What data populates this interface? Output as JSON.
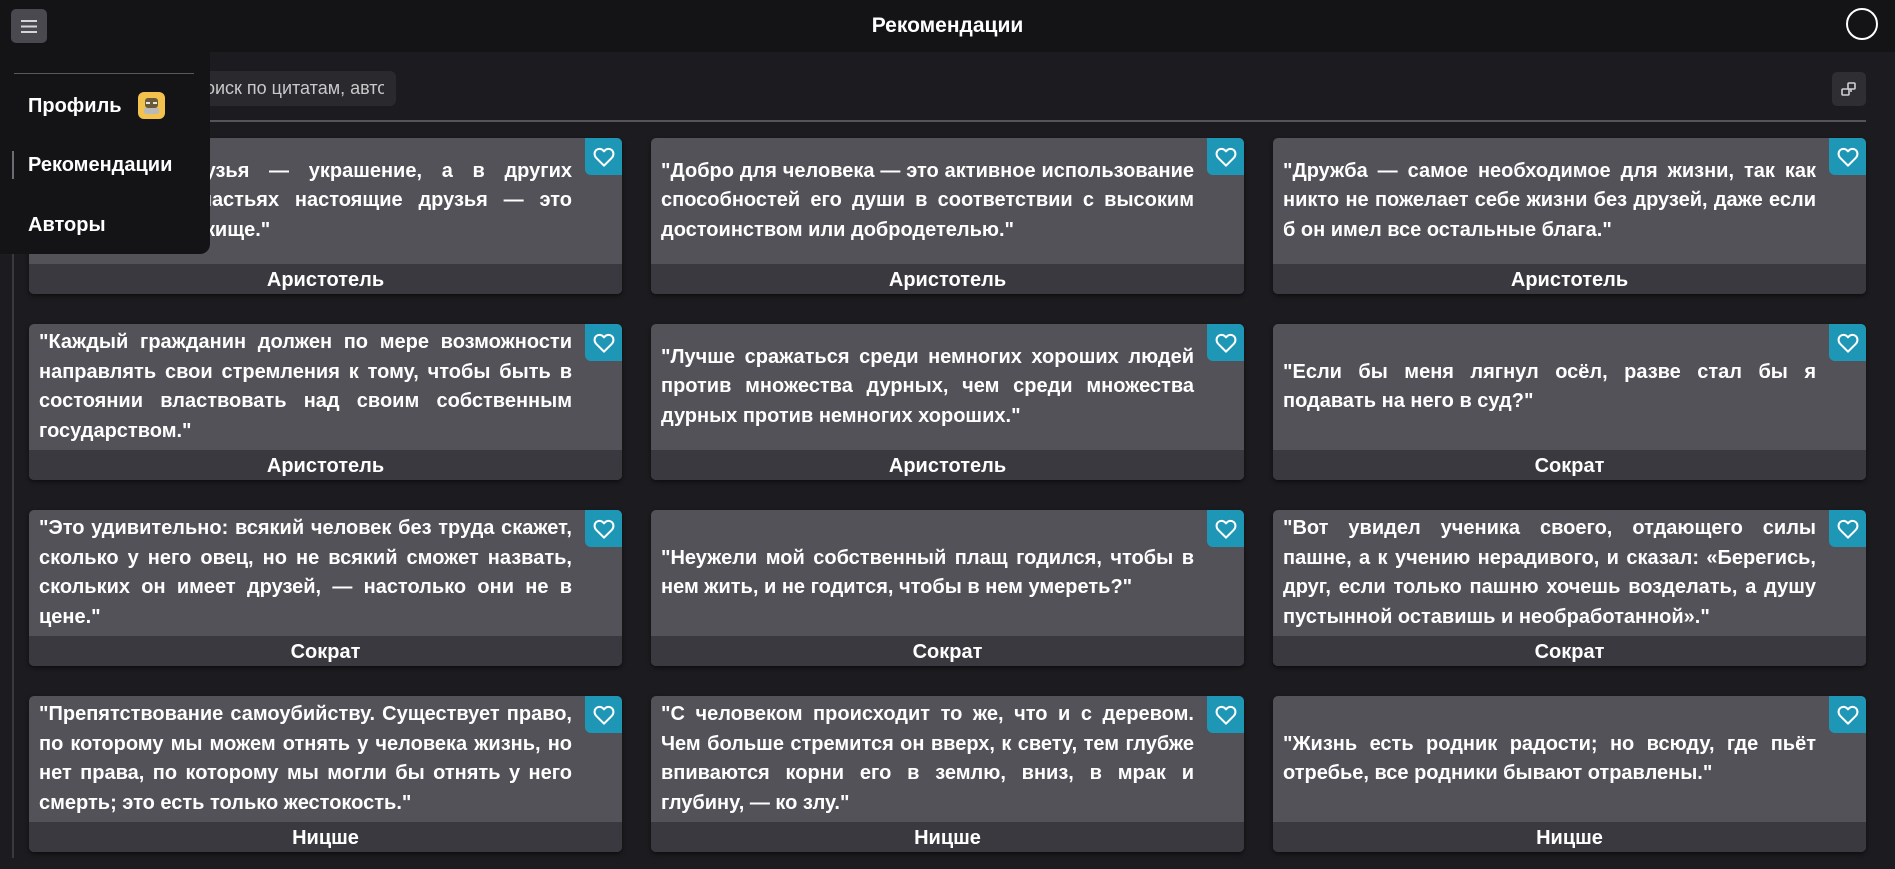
{
  "header": {
    "title": "Рекомендации",
    "menu_icon": "hamburger-icon",
    "profile_icon": "user-circle-icon"
  },
  "search": {
    "placeholder": "Поиск по цитатам, авторам..."
  },
  "filter_icon": "filter-icon",
  "sidebar": {
    "items": [
      {
        "label": "Профиль",
        "icon": "profile-avatar-icon"
      },
      {
        "label": "Рекомендации",
        "active": true
      },
      {
        "label": "Авторы"
      }
    ]
  },
  "colors": {
    "background": "#1c1b1f",
    "topbar": "#141316",
    "card": "#535258",
    "author_bar": "#3a393f",
    "accent": "#1d97b5"
  },
  "cards": [
    {
      "quote": "\"В счастье друзья — украшение, а в других жизненных несчастьях настоящие друзья — это надежное прибежище.\"",
      "author": "Аристотель"
    },
    {
      "quote": "\"Добро для человека — это активное использование способностей его души в соответствии с высоким достоинством или добродетелью.\"",
      "author": "Аристотель"
    },
    {
      "quote": "\"Дружба — самое необходимое для жизни, так как никто не пожелает себе жизни без друзей, даже если б он имел все остальные блага.\"",
      "author": "Аристотель"
    },
    {
      "quote": "\"Каждый гражданин должен по мере возможности направлять свои стремления к тому, чтобы быть в состоянии властвовать над своим собственным государством.\"",
      "author": "Аристотель"
    },
    {
      "quote": "\"Лучше сражаться среди немногих хороших людей против множества дурных, чем среди множества дурных против немногих хороших.\"",
      "author": "Аристотель"
    },
    {
      "quote": "\"Если бы меня лягнул осёл, разве стал бы я подавать на него в суд?\"",
      "author": "Сократ"
    },
    {
      "quote": "\"Это удивительно: всякий человек без труда скажет, сколько у него овец, но не всякий сможет назвать, скольких он имеет друзей, — настолько они не в цене.\"",
      "author": "Сократ"
    },
    {
      "quote": "\"Неужели мой собственный плащ годился, чтобы в нем жить, и не годится, чтобы в нем умереть?\"",
      "author": "Сократ"
    },
    {
      "quote": "\"Вот увидел ученика своего, отдающего силы пашне, а к учению нерадивого, и сказал: «Берегись, друг, если только пашню хочешь возделать, а душу пустынной оставишь и необработанной».\"",
      "author": "Сократ"
    },
    {
      "quote": "\"Препятствование самоубийству. Существует право, по которому мы можем отнять у человека жизнь, но нет права, по которому мы могли бы отнять у него смерть; это есть только жестокость.\"",
      "author": "Ницше"
    },
    {
      "quote": "\"С человеком происходит то же, что и с деревом. Чем больше стремится он вверх, к свету, тем глубже впиваются корни его в землю, вниз, в мрак и глубину, — ко злу.\"",
      "author": "Ницше"
    },
    {
      "quote": "\"Жизнь есть родник радости; но всюду, где пьёт отребье, все родники бывают отравлены.\"",
      "author": "Ницше"
    }
  ]
}
